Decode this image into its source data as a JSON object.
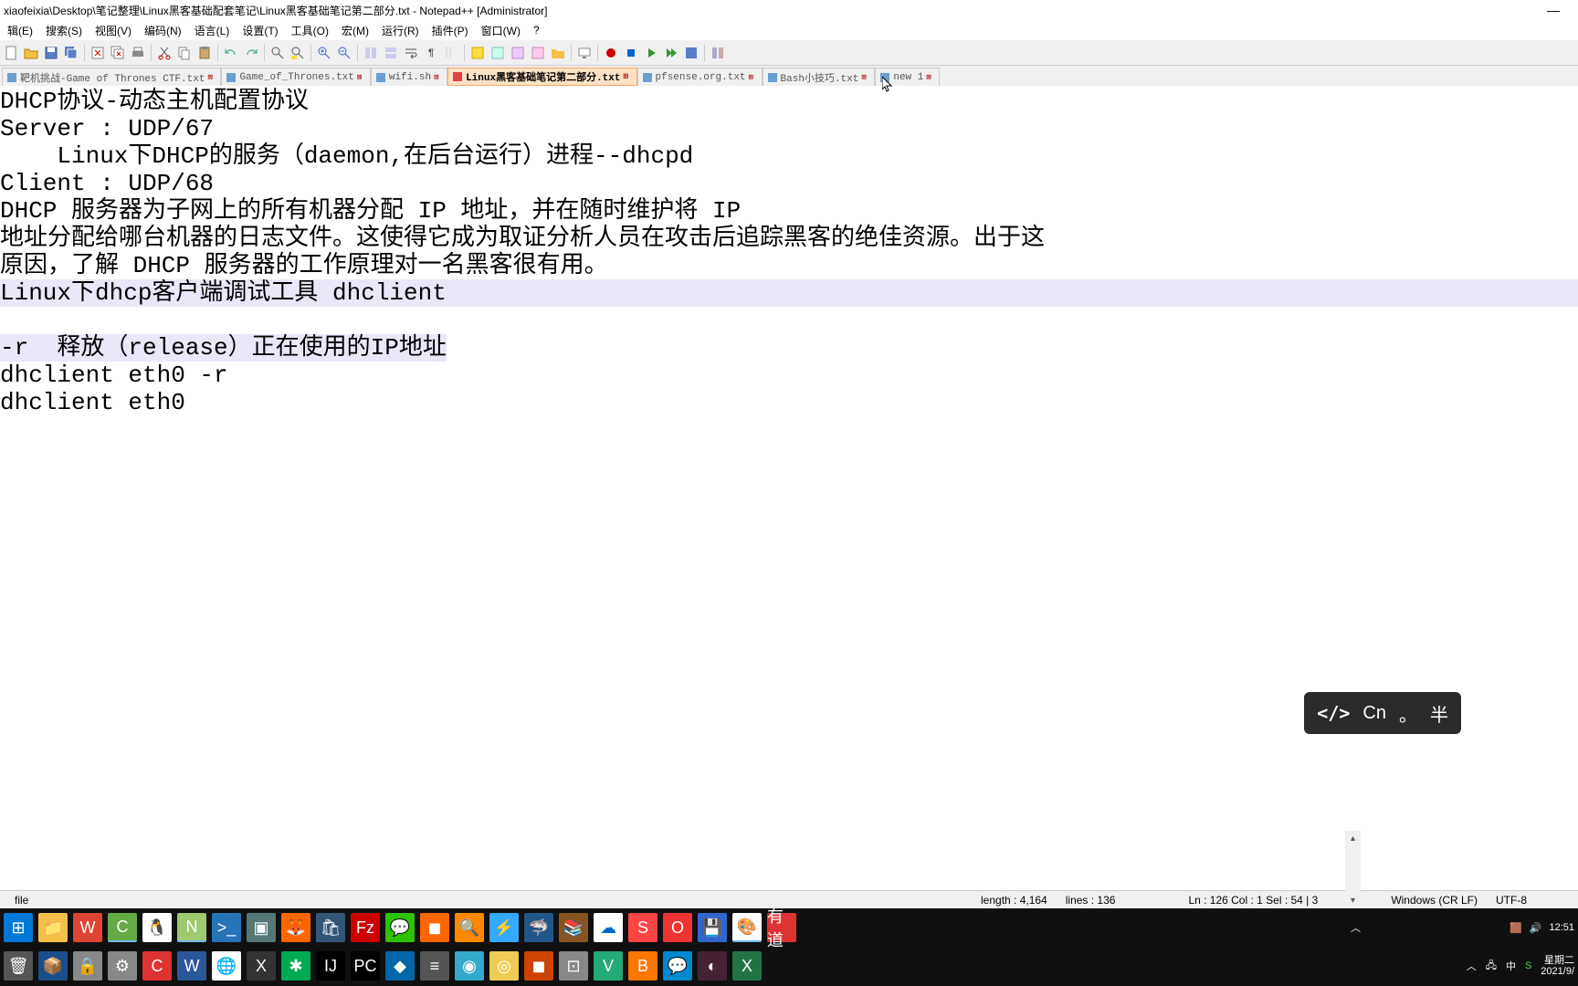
{
  "window": {
    "title": "xiaofeixia\\Desktop\\笔记整理\\Linux黑客基础配套笔记\\Linux黑客基础笔记第二部分.txt - Notepad++ [Administrator]"
  },
  "menu": {
    "edit": "辑(E)",
    "search": "搜索(S)",
    "view": "视图(V)",
    "encoding": "编码(N)",
    "language": "语言(L)",
    "settings": "设置(T)",
    "tools": "工具(O)",
    "macro": "宏(M)",
    "run": "运行(R)",
    "plugins": "插件(P)",
    "window": "窗口(W)",
    "help": "?"
  },
  "tabs": [
    {
      "label": "靶机挑战-Game of Thrones CTF.txt",
      "active": false
    },
    {
      "label": "Game_of_Thrones.txt",
      "active": false
    },
    {
      "label": "wifi.sh",
      "active": false
    },
    {
      "label": "Linux黑客基础笔记第二部分.txt",
      "active": true
    },
    {
      "label": "pfsense.org.txt",
      "active": false
    },
    {
      "label": "Bash小技巧.txt",
      "active": false
    },
    {
      "label": "new 1",
      "active": false
    }
  ],
  "content": {
    "l1": "DHCP协议-动态主机配置协议",
    "l2": "Server : UDP/67",
    "l3": "    Linux下DHCP的服务（daemon,在后台运行）进程--dhcpd",
    "l4": "Client : UDP/68",
    "l5": "",
    "l6": "",
    "l7": "",
    "l8": "DHCP 服务器为子网上的所有机器分配 IP 地址，并在随时维护将 IP",
    "l9": "地址分配给哪台机器的日志文件。这使得它成为取证分析人员在攻击后追踪黑客的绝佳资源。出于这",
    "l10": "原因，了解 DHCP 服务器的工作原理对一名黑客很有用。",
    "l11": "",
    "l12": "",
    "l13": "Linux下dhcp客户端调试工具 dhclient ",
    "l14": "",
    "l15": "-r  释放（release）正在使用的IP地址",
    "l16": "",
    "l17": "dhclient eth0 -r",
    "l18": "",
    "l19": "dhclient eth0",
    "l20": ""
  },
  "status": {
    "left": "file",
    "length": "length : 4,164",
    "lines": "lines : 136",
    "pos": "Ln : 126   Col : 1   Sel : 54 | 3",
    "eol": "Windows (CR LF)",
    "enc": "UTF-8"
  },
  "ime": {
    "lang": "Cn",
    "punct": "。",
    "width": "半"
  },
  "tray": {
    "time": "12:51",
    "date": "2021/9/",
    "day": "星期二",
    "ime": "中"
  }
}
